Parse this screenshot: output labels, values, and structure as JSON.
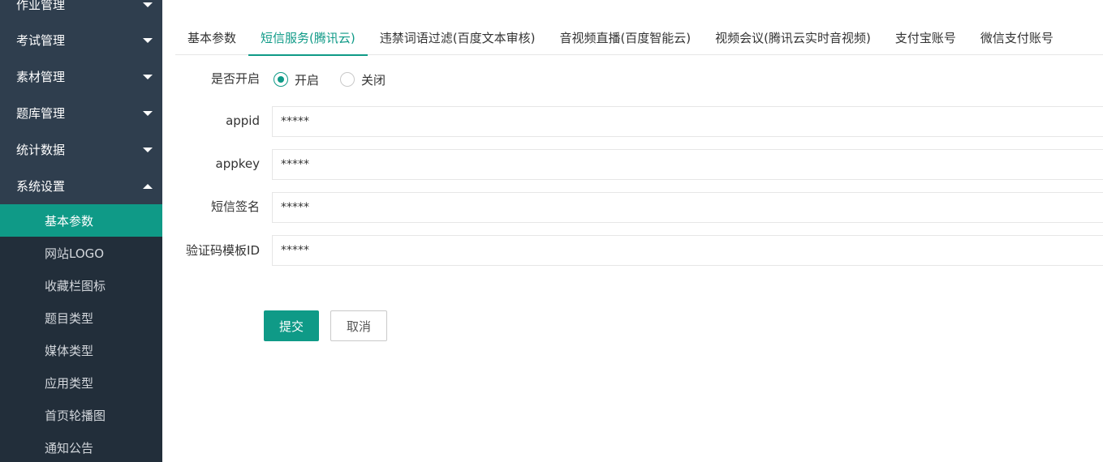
{
  "sidebar": {
    "items": [
      {
        "label": "作业管理",
        "expanded": false
      },
      {
        "label": "考试管理",
        "expanded": false
      },
      {
        "label": "素材管理",
        "expanded": false
      },
      {
        "label": "题库管理",
        "expanded": false
      },
      {
        "label": "统计数据",
        "expanded": false
      },
      {
        "label": "系统设置",
        "expanded": true
      }
    ],
    "sub_items": [
      {
        "label": "基本参数",
        "active": true
      },
      {
        "label": "网站LOGO"
      },
      {
        "label": "收藏栏图标"
      },
      {
        "label": "题目类型"
      },
      {
        "label": "媒体类型"
      },
      {
        "label": "应用类型"
      },
      {
        "label": "首页轮播图"
      },
      {
        "label": "通知公告"
      }
    ]
  },
  "tabs": [
    {
      "label": "基本参数"
    },
    {
      "label": "短信服务(腾讯云)",
      "active": true
    },
    {
      "label": "违禁词语过滤(百度文本审核)"
    },
    {
      "label": "音视频直播(百度智能云)"
    },
    {
      "label": "视频会议(腾讯云实时音视频)"
    },
    {
      "label": "支付宝账号"
    },
    {
      "label": "微信支付账号"
    }
  ],
  "form": {
    "enabled_label": "是否开启",
    "enabled_options": [
      {
        "label": "开启",
        "checked": true
      },
      {
        "label": "关闭",
        "checked": false
      }
    ],
    "fields": [
      {
        "label": "appid",
        "value": "*****"
      },
      {
        "label": "appkey",
        "value": "*****"
      },
      {
        "label": "短信签名",
        "value": "*****"
      },
      {
        "label": "验证码模板ID",
        "value": "*****"
      }
    ],
    "submit_label": "提交",
    "cancel_label": "取消"
  },
  "colors": {
    "accent": "#0f9a87",
    "sidebar_bg": "#2f3e4e",
    "subnav_bg": "#222e3a"
  }
}
